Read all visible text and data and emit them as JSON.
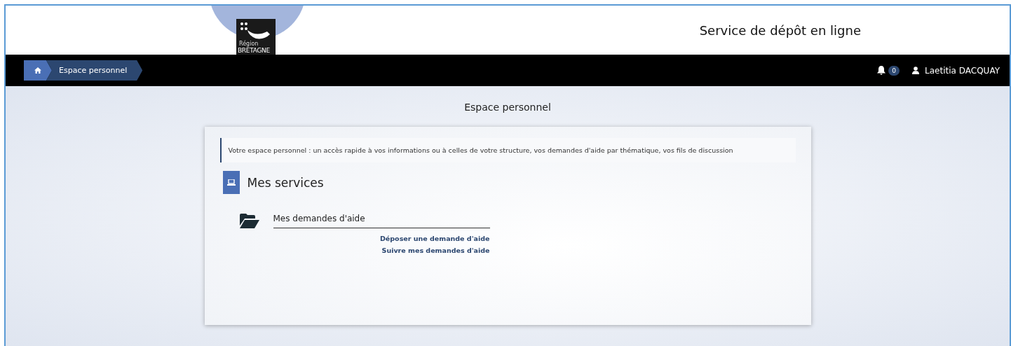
{
  "header": {
    "logo_lines": [
      "Région",
      "BRETAGNE"
    ],
    "title": "Service de dépôt en ligne"
  },
  "navbar": {
    "breadcrumb": [
      {
        "kind": "home"
      },
      {
        "kind": "page",
        "label": "Espace personnel"
      }
    ],
    "notification_count": "0",
    "user_name": "Laetitia DACQUAY"
  },
  "page_title": "Espace personnel",
  "intro": "Votre espace personnel : un accès rapide à vos informations ou à celles de votre structure, vos demandes d'aide par thématique, vos fils de discussion",
  "section": {
    "title": "Mes services",
    "services": [
      {
        "title": "Mes demandes d'aide",
        "links": [
          "Déposer une demande d'aide",
          "Suivre mes demandes d'aide"
        ]
      }
    ]
  }
}
